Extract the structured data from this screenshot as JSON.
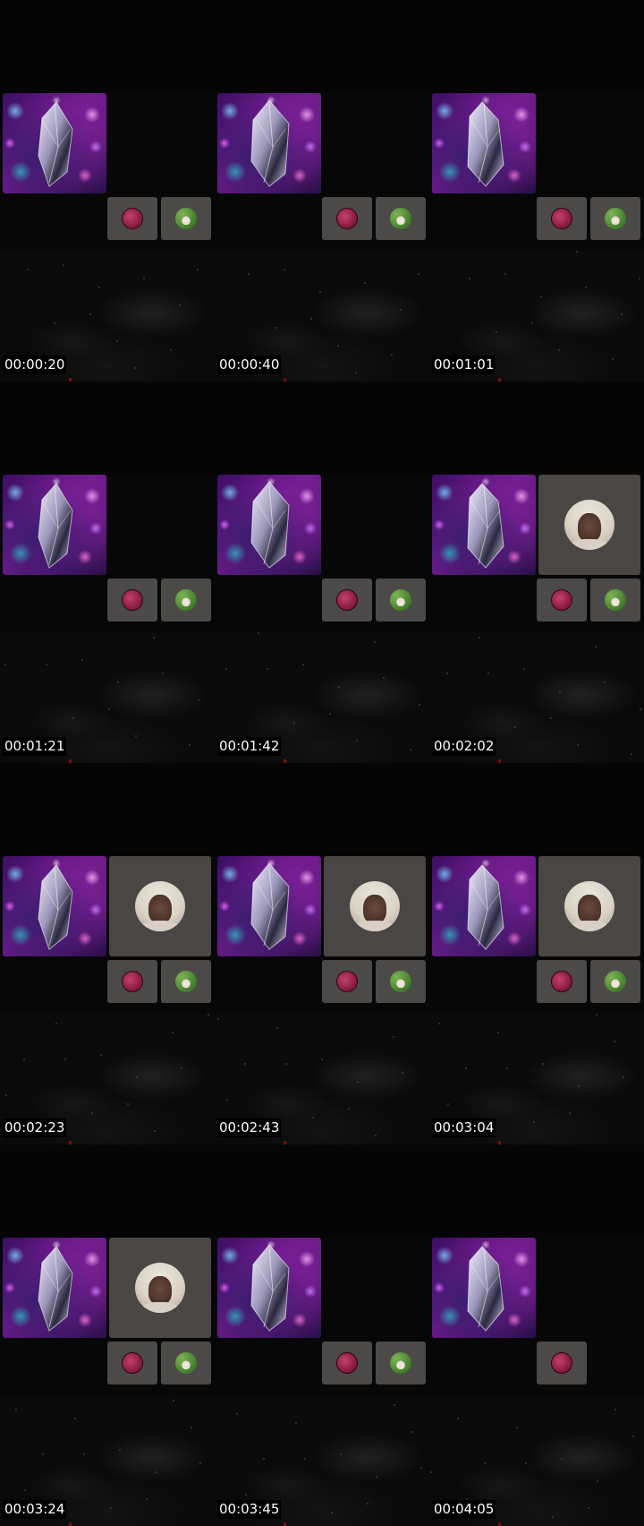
{
  "frames": [
    {
      "timestamp": "00:00:20",
      "person_visible": false,
      "thumbs": [
        "rose",
        "plant"
      ]
    },
    {
      "timestamp": "00:00:40",
      "person_visible": false,
      "thumbs": [
        "rose",
        "plant"
      ]
    },
    {
      "timestamp": "00:01:01",
      "person_visible": false,
      "thumbs": [
        "rose",
        "plant"
      ]
    },
    {
      "timestamp": "00:01:21",
      "person_visible": false,
      "thumbs": [
        "rose",
        "plant"
      ]
    },
    {
      "timestamp": "00:01:42",
      "person_visible": false,
      "thumbs": [
        "rose",
        "plant"
      ]
    },
    {
      "timestamp": "00:02:02",
      "person_visible": true,
      "thumbs": [
        "rose",
        "plant"
      ]
    },
    {
      "timestamp": "00:02:23",
      "person_visible": true,
      "thumbs": [
        "rose",
        "plant"
      ]
    },
    {
      "timestamp": "00:02:43",
      "person_visible": true,
      "thumbs": [
        "rose",
        "plant"
      ]
    },
    {
      "timestamp": "00:03:04",
      "person_visible": true,
      "thumbs": [
        "rose",
        "plant"
      ]
    },
    {
      "timestamp": "00:03:24",
      "person_visible": true,
      "thumbs": [
        "rose",
        "plant"
      ]
    },
    {
      "timestamp": "00:03:45",
      "person_visible": false,
      "thumbs": [
        "rose",
        "plant"
      ]
    },
    {
      "timestamp": "00:04:05",
      "person_visible": false,
      "thumbs": [
        "rose"
      ]
    }
  ],
  "icons": {
    "crystal": "crystal-icon",
    "rose": "rose-avatar-icon",
    "plant": "plant-avatar-icon",
    "person": "person-avatar-icon"
  },
  "colors": {
    "background": "#000000",
    "tile": "#4c4a48",
    "person_tile": "#4a4644",
    "timestamp_text": "#ffffff"
  }
}
